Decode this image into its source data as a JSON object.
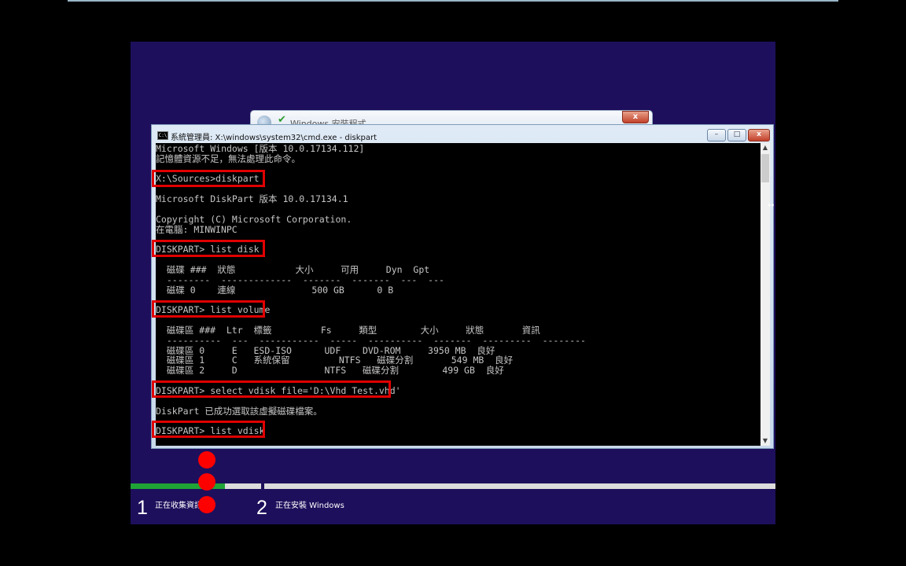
{
  "setup_dialog": {
    "title": "Windows 安裝程式",
    "close_glyph": "x"
  },
  "cmd_window": {
    "title": "系統管理員: X:\\windows\\system32\\cmd.exe - diskpart",
    "controls": {
      "minimize": "–",
      "maximize": "□",
      "close": "x"
    },
    "lines": [
      "Microsoft Windows [版本 10.0.17134.112]",
      "記憶體資源不足，無法處理此命令。",
      "",
      "X:\\Sources>diskpart",
      "",
      "Microsoft DiskPart 版本 10.0.17134.1",
      "",
      "Copyright (C) Microsoft Corporation.",
      "在電腦: MINWINPC",
      "",
      "DISKPART> list disk",
      "",
      "  磁碟 ###  狀態           大小     可用     Dyn  Gpt",
      "  --------  -------------  -------  -------  ---  ---",
      "  磁碟 0    連線              500 GB      0 B",
      "",
      "DISKPART> list volume",
      "",
      "  磁碟區 ###  Ltr  標籤         Fs     類型        大小     狀態       資訊",
      "  ----------  ---  -----------  -----  ----------  -------  ---------  --------",
      "  磁碟區 0     E   ESD-ISO      UDF    DVD-ROM     3950 MB  良好",
      "  磁碟區 1     C   系統保留         NTFS   磁碟分割       549 MB  良好",
      "  磁碟區 2     D                NTFS   磁碟分割        499 GB  良好",
      "",
      "DISKPART> select vdisk file='D:\\Vhd_Test.vhd'",
      "",
      "DiskPart 已成功選取該虛擬磁碟檔案。",
      "",
      "DISKPART> list vdisk"
    ]
  },
  "progress": {
    "steps": [
      {
        "number": "1",
        "label": "正在收集資訊",
        "fill_percent": 72
      },
      {
        "number": "2",
        "label": "正在安裝 Windows",
        "fill_percent": 0
      }
    ]
  },
  "colors": {
    "accent_green": "#1fa336",
    "highlight_red": "#e00000",
    "setup_bg": "#1e0f5c"
  }
}
